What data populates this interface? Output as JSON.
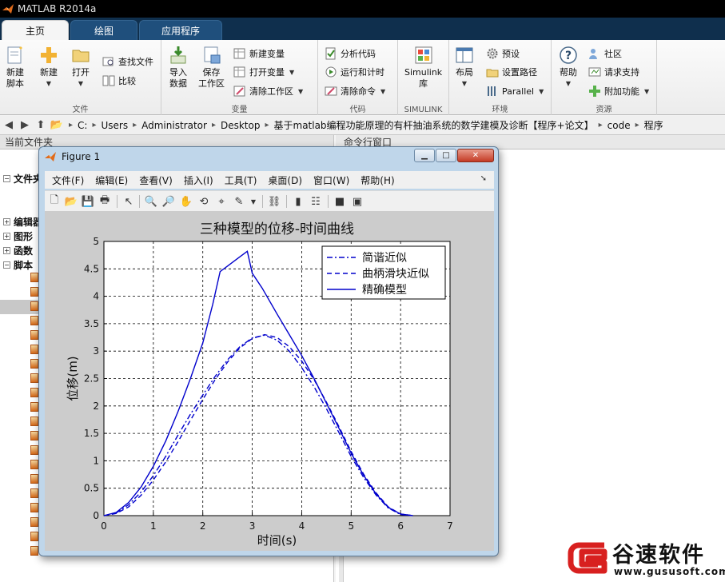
{
  "window": {
    "title": "MATLAB R2014a"
  },
  "tabs": [
    "主页",
    "绘图",
    "应用程序"
  ],
  "ribbon": {
    "file": {
      "title": "文件",
      "new_script": [
        "新建",
        "脚本"
      ],
      "new": "新建",
      "open": "打开",
      "find_files": "查找文件",
      "compare": "比较"
    },
    "variable": {
      "title": "变量",
      "import": [
        "导入",
        "数据"
      ],
      "save": [
        "保存",
        "工作区"
      ],
      "new_var": "新建变量",
      "open_var": "打开变量",
      "clear_ws": "清除工作区"
    },
    "code": {
      "title": "代码",
      "analyze": "分析代码",
      "run_time": "运行和计时",
      "clear_cmd": "清除命令"
    },
    "simulink": {
      "title": "SIMULINK",
      "label": [
        "Simulink",
        "库"
      ]
    },
    "env": {
      "title": "环境",
      "layout": "布局",
      "prefs": "预设",
      "set_path": "设置路径",
      "parallel": "Parallel"
    },
    "resources": {
      "title": "资源",
      "help": "帮助",
      "community": "社区",
      "support": "请求支持",
      "addons": "附加功能"
    }
  },
  "address": {
    "crumbs": [
      "C:",
      "Users",
      "Administrator",
      "Desktop",
      "基于matlab编程功能原理的有杆抽油系统的数学建模及诊断【程序+论文】",
      "code",
      "程序"
    ]
  },
  "left_panel": {
    "title": "当前文件夹",
    "tree": [
      "文件夹",
      "编辑器",
      "图形",
      "函数",
      "脚本"
    ]
  },
  "right_panel": {
    "title": "命令行窗口"
  },
  "figure": {
    "title": "Figure 1",
    "menu": [
      "文件(F)",
      "编辑(E)",
      "查看(V)",
      "插入(I)",
      "工具(T)",
      "桌面(D)",
      "窗口(W)",
      "帮助(H)"
    ]
  },
  "chart_data": {
    "type": "line",
    "title": "三种模型的位移-时间曲线",
    "xlabel": "时间(s)",
    "ylabel": "位移(m)",
    "xlim": [
      0,
      7
    ],
    "ylim": [
      0,
      5
    ],
    "xticks": [
      0,
      1,
      2,
      3,
      4,
      5,
      6,
      7
    ],
    "yticks": [
      0,
      0.5,
      1,
      1.5,
      2,
      2.5,
      3,
      3.5,
      4,
      4.5,
      5
    ],
    "grid": true,
    "legend_position": "top-right",
    "series": [
      {
        "name": "简谐近似",
        "style": "dashdot",
        "color": "#0000cc",
        "x": [
          0,
          0.25,
          0.5,
          0.75,
          1.0,
          1.25,
          1.5,
          1.75,
          2.0,
          2.25,
          2.5,
          2.75,
          3.0,
          3.25,
          3.5,
          3.75,
          4.0,
          4.25,
          4.5,
          4.75,
          5.0,
          5.25,
          5.5,
          5.75,
          6.0,
          6.25
        ],
        "y": [
          0,
          0.05,
          0.2,
          0.43,
          0.73,
          1.08,
          1.47,
          1.85,
          2.2,
          2.54,
          2.84,
          3.08,
          3.24,
          3.29,
          3.2,
          3.0,
          2.7,
          2.35,
          1.95,
          1.52,
          1.08,
          0.7,
          0.38,
          0.14,
          0.02,
          0
        ]
      },
      {
        "name": "曲柄滑块近似",
        "style": "dashed",
        "color": "#0000cc",
        "x": [
          0,
          0.25,
          0.5,
          0.75,
          1.0,
          1.25,
          1.5,
          1.75,
          2.0,
          2.25,
          2.5,
          2.75,
          3.0,
          3.25,
          3.5,
          3.75,
          4.0,
          4.25,
          4.5,
          4.75,
          5.0,
          5.25,
          5.5,
          5.75,
          6.0,
          6.25
        ],
        "y": [
          0,
          0.04,
          0.16,
          0.37,
          0.65,
          0.98,
          1.35,
          1.74,
          2.12,
          2.48,
          2.8,
          3.06,
          3.23,
          3.3,
          3.25,
          3.08,
          2.82,
          2.48,
          2.07,
          1.63,
          1.17,
          0.76,
          0.42,
          0.16,
          0.03,
          0
        ]
      },
      {
        "name": "精确模型",
        "style": "solid",
        "color": "#0000cc",
        "x": [
          0,
          0.25,
          0.5,
          0.75,
          1.0,
          1.25,
          1.5,
          1.75,
          2.0,
          2.2,
          2.35,
          2.5,
          2.75,
          2.9,
          3.0,
          3.2,
          3.5,
          3.75,
          4.0,
          4.25,
          4.5,
          4.75,
          5.0,
          5.25,
          5.5,
          5.75,
          6.0,
          6.25
        ],
        "y": [
          0,
          0.06,
          0.24,
          0.52,
          0.9,
          1.36,
          1.9,
          2.5,
          3.15,
          3.85,
          4.45,
          4.55,
          4.72,
          4.82,
          4.42,
          4.15,
          3.68,
          3.3,
          2.92,
          2.5,
          2.05,
          1.6,
          1.14,
          0.74,
          0.4,
          0.15,
          0.03,
          0
        ]
      }
    ]
  },
  "watermark": {
    "name": "谷速软件",
    "url": "www.gususoft.com"
  }
}
